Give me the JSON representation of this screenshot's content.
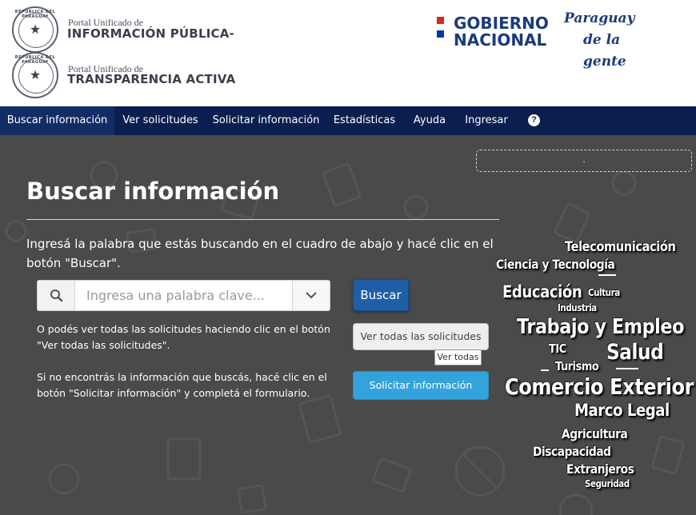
{
  "header": {
    "portal1": {
      "small": "Portal Unificado de",
      "big": "INFORMACIÓN PÚBLICA-"
    },
    "portal2": {
      "small": "Portal Unificado de",
      "big": "TRANSPARENCIA ACTIVA"
    },
    "seal_text": "REPÚBLICA DEL PARAGUAY",
    "gobierno": {
      "line1": "GOBIERNO",
      "line2": "NACIONAL",
      "flag_colors": [
        "#d52b1e",
        "#ffffff",
        "#0038a8"
      ]
    },
    "slogan": {
      "line1": "Paraguay",
      "line2": "de la gente"
    }
  },
  "nav": {
    "items": [
      {
        "label": "Buscar información"
      },
      {
        "label": "Ver solicitudes"
      },
      {
        "label": "Solicitar información"
      },
      {
        "label": "Estadísticas"
      },
      {
        "label": "Ayuda"
      },
      {
        "label": "Ingresar"
      }
    ],
    "help_icon": "question-circle-icon"
  },
  "main": {
    "notice": ".",
    "title": "Buscar información",
    "intro": "Ingresá la palabra que estás buscando en el cuadro de abajo y hacé clic en el botón \"Buscar\".",
    "search": {
      "placeholder": "Ingresa una palabra clave...",
      "value": ""
    },
    "search_button": "Buscar",
    "help_ver": "O podés ver todas las solicitudes haciendo clic en el botón \"Ver todas las solicitudes\".",
    "ver_todas_button": "Ver todas las solicitudes",
    "tooltip": "Ver todas",
    "help_solicitar": "Si no encontrás la información que buscás, hacé clic en el botón \"Solicitar información\" y completá el formulario.",
    "solicitar_button": "Solicitar información"
  },
  "tag_cloud": [
    "Telecomunicación",
    "Ciencia y Tecnología",
    "Educación",
    "Cultura",
    "Industria",
    "Trabajo y Empleo",
    "TIC",
    "Salud",
    "Turismo",
    "Comercio Exterior",
    "Marco Legal",
    "Agricultura",
    "Discapacidad",
    "Extranjeros",
    "Seguridad"
  ],
  "colors": {
    "nav_bg": "#0a1f4f",
    "main_bg": "#4a4a4a",
    "buscar_btn": "#1f5ea8",
    "solicitar_btn": "#33a3dc",
    "brand_blue": "#1b3a7a"
  }
}
